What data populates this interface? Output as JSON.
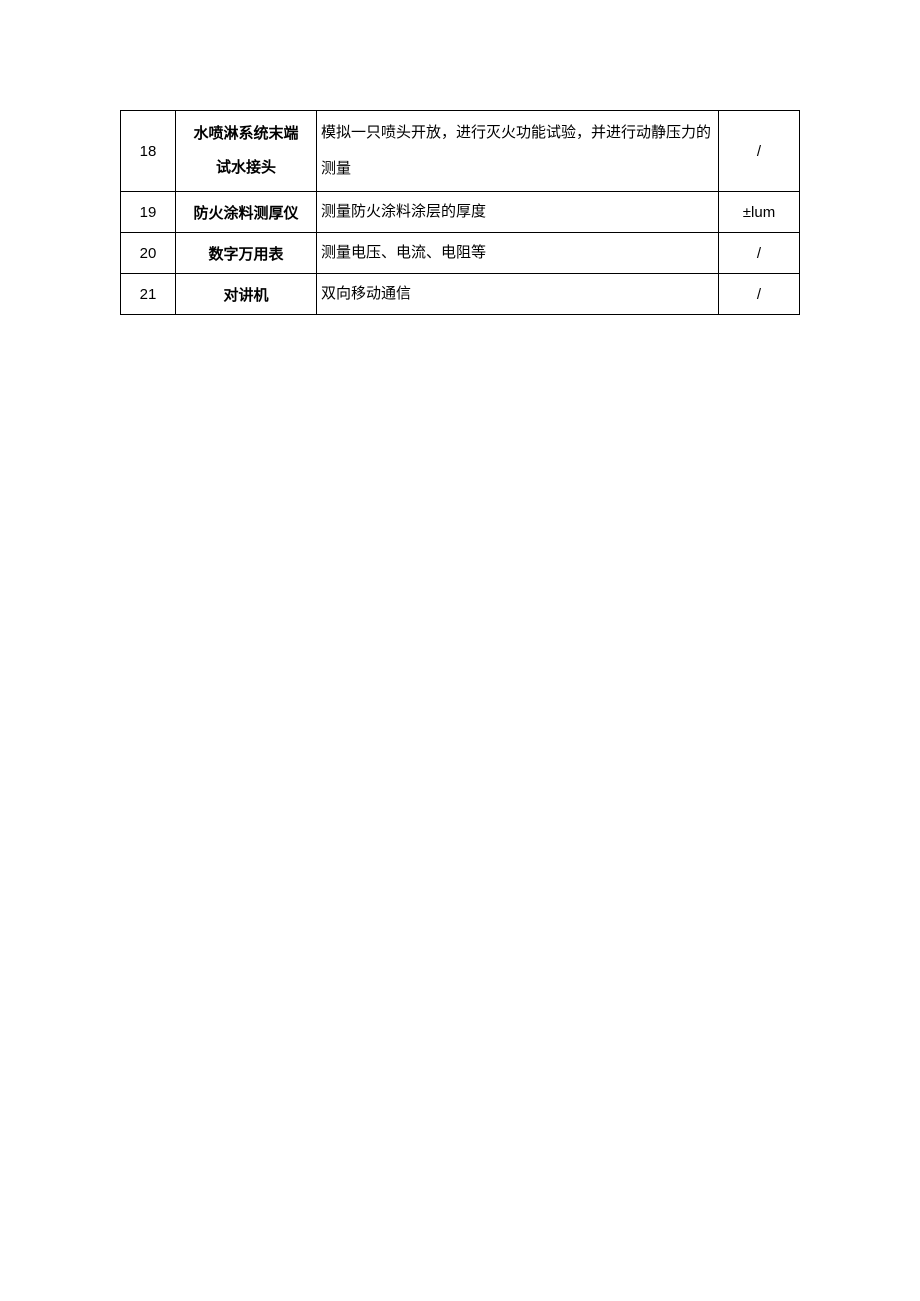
{
  "table": {
    "rows": [
      {
        "num": "18",
        "name_line1": "水喷淋系统末端",
        "name_line2": "试水接头",
        "desc": "模拟一只喷头开放，进行灭火功能试验，并进行动静压力的测量",
        "spec": "/"
      },
      {
        "num": "19",
        "name": "防火涂料测厚仪",
        "desc": "测量防火涂料涂层的厚度",
        "spec": "±lum"
      },
      {
        "num": "20",
        "name": "数字万用表",
        "desc": "测量电压、电流、电阻等",
        "spec": "/"
      },
      {
        "num": "21",
        "name": "对讲机",
        "desc": "双向移动通信",
        "spec": "/"
      }
    ]
  }
}
